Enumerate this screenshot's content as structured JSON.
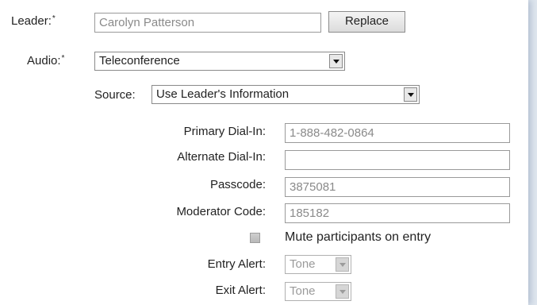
{
  "leader": {
    "label": "Leader:",
    "required": "*",
    "value": "Carolyn Patterson",
    "replace_label": "Replace"
  },
  "audio": {
    "label": "Audio:",
    "required": "*",
    "value": "Teleconference"
  },
  "source": {
    "label": "Source:",
    "value": "Use Leader's Information"
  },
  "primary_dial_in": {
    "label": "Primary Dial-In:",
    "value": "1-888-482-0864"
  },
  "alternate_dial_in": {
    "label": "Alternate Dial-In:",
    "value": ""
  },
  "passcode": {
    "label": "Passcode:",
    "value": "3875081"
  },
  "moderator_code": {
    "label": "Moderator Code:",
    "value": "185182"
  },
  "mute": {
    "label": "Mute participants on entry",
    "checked": false
  },
  "entry_alert": {
    "label": "Entry Alert:",
    "value": "Tone"
  },
  "exit_alert": {
    "label": "Exit Alert:",
    "value": "Tone"
  }
}
